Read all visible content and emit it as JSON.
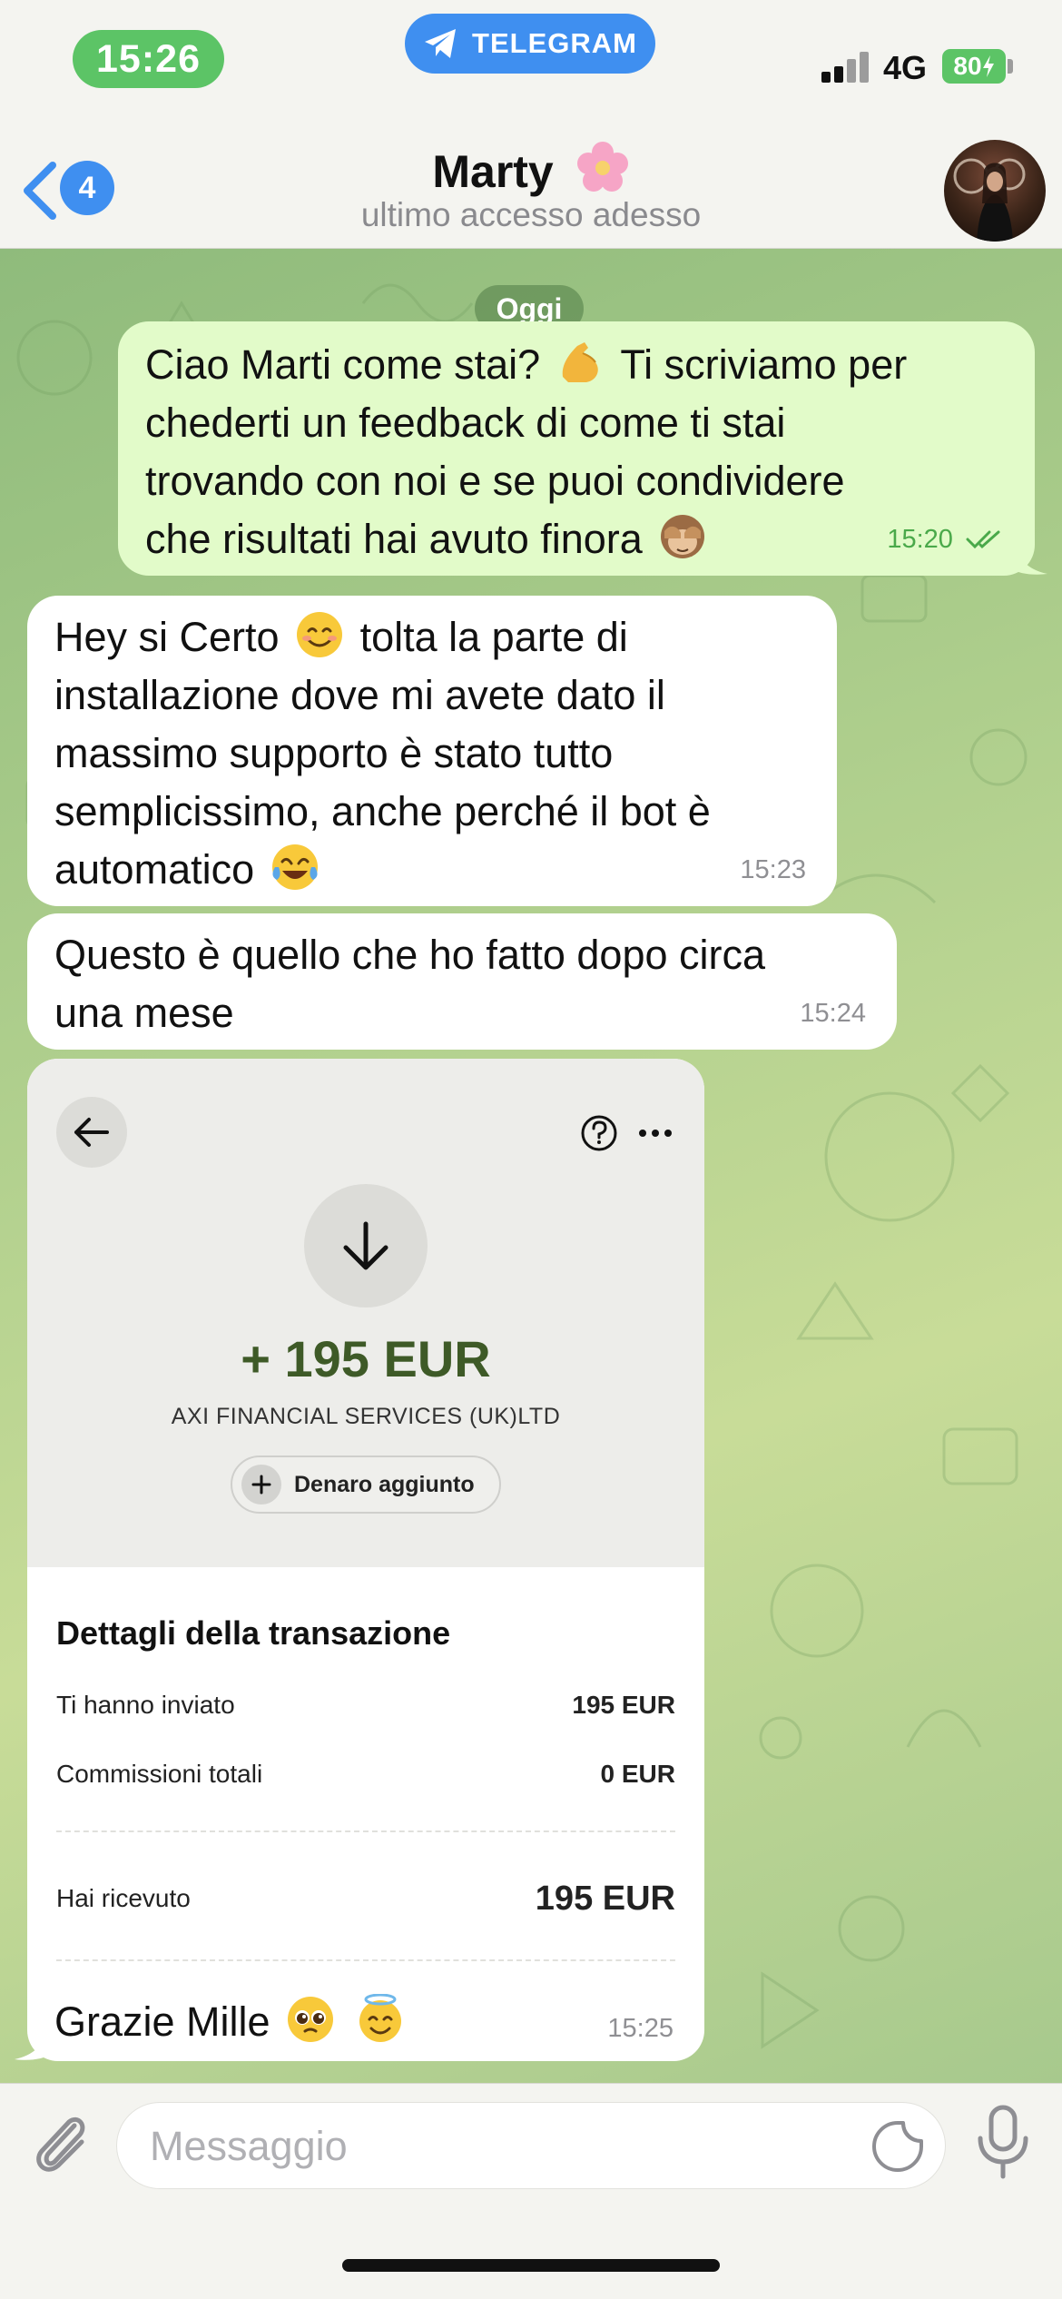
{
  "status_bar": {
    "time": "15:26",
    "app_pill": "TELEGRAM",
    "network": "4G",
    "battery": "80"
  },
  "header": {
    "back_count": "4",
    "title": "Marty",
    "subtitle": "ultimo accesso adesso"
  },
  "chat": {
    "date_label": "Oggi",
    "messages": [
      {
        "direction": "out",
        "text_parts": [
          "Ciao Marti come stai? ",
          " Ti scriviamo per\nchederti un feedback di come ti stai\ntrovando con noi e se puoi condividere\nche risultati hai avuto finora "
        ],
        "emojis": [
          "flexed-biceps-emoji",
          "see-no-evil-monkey-emoji"
        ],
        "time": "15:20",
        "read": true
      },
      {
        "direction": "in",
        "text_parts": [
          "Hey si Certo ",
          " tolta la parte di\ninstallazione dove mi avete dato il\nmassimo supporto è stato tutto\nsemplicissimo, anche perché il bot è\nautomatico "
        ],
        "emojis": [
          "smiling-face-emoji",
          "tears-of-joy-emoji"
        ],
        "time": "15:23"
      },
      {
        "direction": "in",
        "text": "Questo è quello che ho fatto dopo circa\nuna mese",
        "time": "15:24"
      },
      {
        "direction": "in",
        "type": "photo",
        "caption": "Grazie Mille",
        "caption_emojis": [
          "pleading-face-emoji",
          "halo-face-emoji"
        ],
        "time": "15:25",
        "screenshot": {
          "amount": "+ 195 EUR",
          "from": "AXI FINANCIAL SERVICES (UK)LTD",
          "status_button": "Denaro aggiunto",
          "details_title": "Dettagli della transazione",
          "rows": [
            {
              "label": "Ti hanno inviato",
              "value": "195 EUR"
            },
            {
              "label": "Commissioni totali",
              "value": "0 EUR"
            },
            {
              "label": "Hai ricevuto",
              "value": "195 EUR"
            }
          ]
        }
      }
    ]
  },
  "input": {
    "placeholder": "Messaggio"
  },
  "colors": {
    "outgoing_bubble": "#e2fbc9",
    "incoming_bubble": "#ffffff",
    "accent": "#3f8ff0",
    "read_check": "#4aa94a",
    "amount_green": "#3e5a27"
  }
}
